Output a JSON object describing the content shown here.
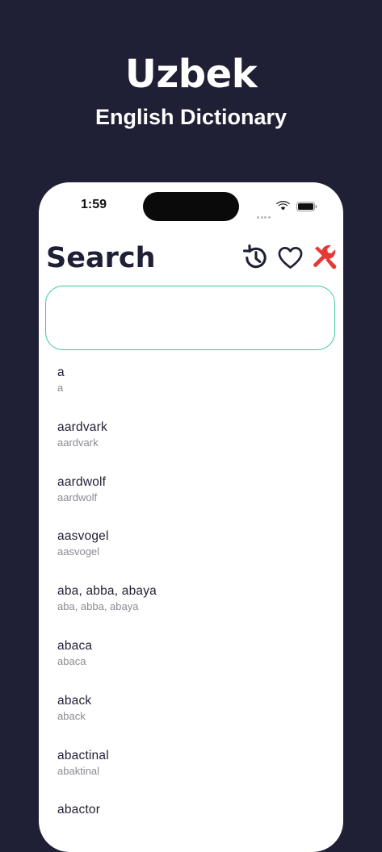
{
  "promo": {
    "title": "Uzbek",
    "subtitle": "English Dictionary"
  },
  "status_bar": {
    "time": "1:59"
  },
  "header": {
    "title": "Search"
  },
  "icons": {
    "history": "history-icon",
    "favorites": "heart-icon",
    "settings": "tools-icon"
  },
  "colors": {
    "background": "#1f1f35",
    "text_primary": "#1f1f35",
    "text_secondary": "#8a8a94",
    "input_border": "#3cc99a",
    "settings_icon": "#e53935"
  },
  "search": {
    "value": "",
    "placeholder": ""
  },
  "results": [
    {
      "word": "a",
      "translation": "a"
    },
    {
      "word": "aardvark",
      "translation": "aardvark"
    },
    {
      "word": "aardwolf",
      "translation": "aardwolf"
    },
    {
      "word": "aasvogel",
      "translation": "aasvogel"
    },
    {
      "word": "aba, abba, abaya",
      "translation": "aba, abba, abaya"
    },
    {
      "word": "abaca",
      "translation": "abaca"
    },
    {
      "word": "aback",
      "translation": "aback"
    },
    {
      "word": "abactinal",
      "translation": "abaktinal"
    },
    {
      "word": "abactor",
      "translation": ""
    }
  ]
}
